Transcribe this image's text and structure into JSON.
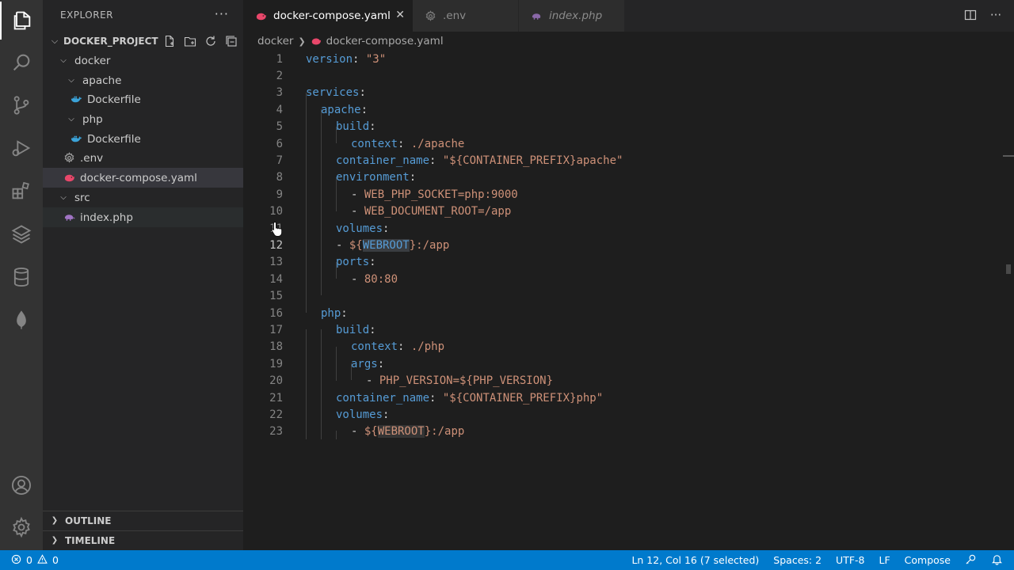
{
  "sidebar": {
    "title": "EXPLORER",
    "more": "···",
    "project": "DOCKER_PROJECT",
    "tree": [
      {
        "label": "docker",
        "kind": "folder"
      },
      {
        "label": "apache",
        "kind": "folder"
      },
      {
        "label": "Dockerfile",
        "kind": "docker"
      },
      {
        "label": "php",
        "kind": "folder"
      },
      {
        "label": "Dockerfile",
        "kind": "docker"
      },
      {
        "label": ".env",
        "kind": "gear"
      },
      {
        "label": "docker-compose.yaml",
        "kind": "compose"
      },
      {
        "label": "src",
        "kind": "folder"
      },
      {
        "label": "index.php",
        "kind": "php"
      }
    ],
    "outline": "OUTLINE",
    "timeline": "TIMELINE"
  },
  "tabs": [
    {
      "label": "docker-compose.yaml",
      "active": true
    },
    {
      "label": ".env",
      "active": false
    },
    {
      "label": "index.php",
      "active": false
    }
  ],
  "breadcrumb": {
    "folder": "docker",
    "file": "docker-compose.yaml"
  },
  "editor": {
    "current_line": 12,
    "lines": [
      {
        "n": "1"
      },
      {
        "n": "2"
      },
      {
        "n": "3"
      },
      {
        "n": "4"
      },
      {
        "n": "5"
      },
      {
        "n": "6"
      },
      {
        "n": "7"
      },
      {
        "n": "8"
      },
      {
        "n": "9"
      },
      {
        "n": "10"
      },
      {
        "n": "11"
      },
      {
        "n": "12"
      },
      {
        "n": "13"
      },
      {
        "n": "14"
      },
      {
        "n": "15"
      },
      {
        "n": "16"
      },
      {
        "n": "17"
      },
      {
        "n": "18"
      },
      {
        "n": "19"
      },
      {
        "n": "20"
      },
      {
        "n": "21"
      },
      {
        "n": "22"
      },
      {
        "n": "23"
      }
    ],
    "code": {
      "l1_key": "version",
      "l1_colon": ": ",
      "l1_val": "\"3\"",
      "l3_key": "services",
      "l3_colon": ":",
      "l4_key": "apache",
      "l4_colon": ":",
      "l5_key": "build",
      "l5_colon": ":",
      "l6_key": "context",
      "l6_colon": ": ",
      "l6_val": "./apache",
      "l7_key": "container_name",
      "l7_colon": ": ",
      "l7_val": "\"${CONTAINER_PREFIX}apache\"",
      "l8_key": "environment",
      "l8_colon": ":",
      "l9_dash": "- ",
      "l9_val": "WEB_PHP_SOCKET=php:9000",
      "l10_dash": "- ",
      "l10_val": "WEB_DOCUMENT_ROOT=/app",
      "l11_key": "volumes",
      "l11_colon": ":",
      "l12_dash": "- ",
      "l12_pre": "${",
      "l12_sel": "WEBROOT",
      "l12_post": "}:/app",
      "l13_key": "ports",
      "l13_colon": ":",
      "l14_dash": "- ",
      "l14_val": "80:80",
      "l16_key": "php",
      "l16_colon": ":",
      "l17_key": "build",
      "l17_colon": ":",
      "l18_key": "context",
      "l18_colon": ": ",
      "l18_val": "./php",
      "l19_key": "args",
      "l19_colon": ":",
      "l20_dash": "- ",
      "l20_val": "PHP_VERSION=${PHP_VERSION}",
      "l21_key": "container_name",
      "l21_colon": ": ",
      "l21_val": "\"${CONTAINER_PREFIX}php\"",
      "l22_key": "volumes",
      "l22_colon": ":",
      "l23_dash": "- ",
      "l23_pre": "${",
      "l23_hl": "WEBROOT",
      "l23_post": "}:/app"
    }
  },
  "statusbar": {
    "errors": "0",
    "warnings": "0",
    "position": "Ln 12, Col 16 (7 selected)",
    "spaces": "Spaces: 2",
    "encoding": "UTF-8",
    "eol": "LF",
    "language": "Compose"
  },
  "colors": {
    "accent": "#007acc",
    "keyword": "#569cd6",
    "string": "#ce9178",
    "compose_icon": "#e8476a",
    "docker_icon": "#3ba3d9",
    "php_icon": "#a074c4"
  }
}
